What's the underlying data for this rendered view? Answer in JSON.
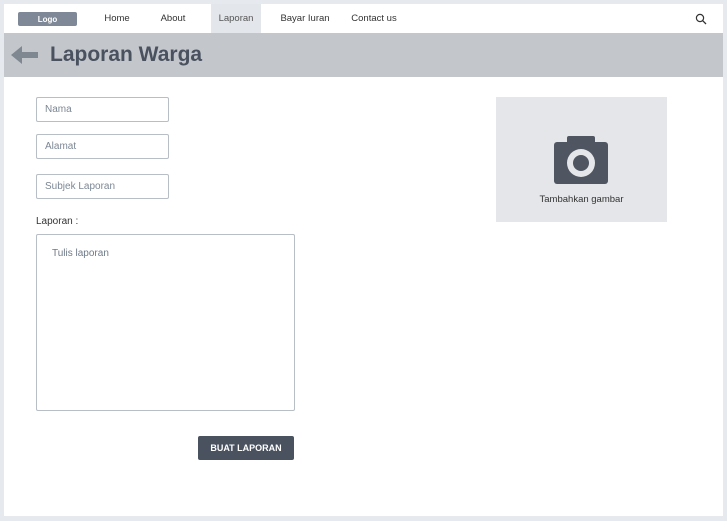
{
  "nav": {
    "logo": "Logo",
    "items": [
      "Home",
      "About",
      "Laporan",
      "Bayar Iuran",
      "Contact us"
    ],
    "active": "Laporan"
  },
  "header": {
    "title": "Laporan Warga"
  },
  "form": {
    "nama_placeholder": "Nama",
    "alamat_placeholder": "Alamat",
    "subjek_placeholder": "Subjek Laporan",
    "laporan_label": "Laporan :",
    "laporan_placeholder": "Tulis laporan",
    "submit_label": "BUAT LAPORAN"
  },
  "image_upload": {
    "caption": "Tambahkan gambar"
  },
  "colors": {
    "header_bg": "#c3c7cc",
    "button_bg": "#4a5260",
    "logo_bg": "#7e8896"
  }
}
